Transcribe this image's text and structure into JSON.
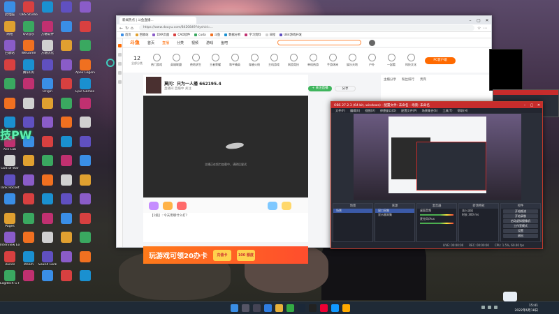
{
  "desktop": {
    "overlay_text": "技PW",
    "icons_col1": [
      "此电脑",
      "网络",
      "回收站",
      "",
      "",
      "",
      "",
      "Ace Lab",
      "God of War",
      "Tank Rocket",
      "",
      "Pages",
      "Interview Experience",
      "iTunes",
      "Logitech G HUB"
    ],
    "icons_col2": [
      "OBS Studio",
      "QQ音乐",
      "WeGame",
      "腾讯QQ",
      "",
      "",
      "",
      "",
      "",
      "",
      "",
      "",
      "",
      "steam",
      ""
    ],
    "icons_col3": [
      "",
      "方糖软件",
      "方糖优化",
      "",
      "Origin",
      "",
      "",
      "",
      "",
      "",
      "",
      "",
      "",
      "Sound Lock",
      ""
    ],
    "icons_col4": [
      "",
      "",
      "",
      "",
      "",
      "",
      "",
      "",
      "",
      "",
      "",
      "",
      "",
      "",
      ""
    ],
    "icons_col5": [
      "",
      "",
      "",
      "Apex Legends",
      "Epic Games Launcher",
      "",
      "",
      "",
      "",
      "",
      "",
      "",
      "",
      "",
      ""
    ]
  },
  "browser": {
    "tab_title": "新闻热点 | 斗鱼直播...",
    "url": "https://www.douyu.com/8420849?dyshid=...",
    "favorites": [
      "首页",
      "回收站",
      "DXR页面",
      "CAD软件",
      "cuda",
      "斗鱼",
      "数据分析",
      "学习资料",
      "日程",
      "UE4游戏开发"
    ],
    "site": {
      "logo": "斗鱼",
      "nav": [
        "首页",
        "直播",
        "分类",
        "视频",
        "游戏",
        "鱼吧"
      ],
      "active_nav": "直播",
      "pc_button": "PC客户端"
    },
    "category": {
      "count": "12",
      "count_label": "全部分类",
      "items": [
        "热门游戏",
        "英雄联盟",
        "绝地求生",
        "王者荣耀",
        "和平精英",
        "穿越火线",
        "主机游戏",
        "网游竞技",
        "单机热游",
        "手游休闲",
        "娱乐天地",
        "户外",
        "一起看",
        "科技文化"
      ]
    },
    "streamer": {
      "title": "莫问：只为一人播",
      "fans": "662195.4",
      "subtitle": "直播间 直播中 关注",
      "follow_label": "+ 关注直播",
      "share_label": "分享"
    },
    "video": {
      "loading_text": "主播正在努力加载中，请稍后尝试"
    },
    "chat_line": "【1级】: 今天用哪什么打?",
    "banner": {
      "text": "玩游戏可领20办卡",
      "btn1": "充值卡",
      "btn2": "100 额度"
    },
    "right_tabs": [
      "主播分享",
      "粉丝排行",
      "贵宾"
    ]
  },
  "obs": {
    "title": "OBS 27.2.3 (64 bit, windows) - 配置文件: 未命名 - 场景: 未命名",
    "menu": [
      "文件(F)",
      "编辑(E)",
      "视图(V)",
      "停靠窗口(D)",
      "配置文件(P)",
      "场景集合(S)",
      "工具(T)",
      "帮助(H)"
    ],
    "docks": {
      "scenes": {
        "header": "场景",
        "items": [
          "场景"
        ]
      },
      "sources": {
        "header": "来源",
        "items": [
          "窗口采集",
          "显示器采集"
        ]
      },
      "mixer": {
        "header": "混音器",
        "items": [
          "桌面音频",
          "麦克风/Aux"
        ]
      },
      "transitions": {
        "header": "转场特效",
        "items": [
          "淡入淡出",
          "时长 300 ms"
        ]
      },
      "controls": {
        "header": "控件",
        "buttons": [
          "开始推流",
          "开始录制",
          "启动虚拟摄像机",
          "工作室模式",
          "设置",
          "退出"
        ]
      }
    },
    "status": [
      "LIVE: 00:00:00",
      "REC: 00:00:00",
      "CPU: 1.5%, 60.00 fps"
    ]
  },
  "taskbar": {
    "time": "15:41",
    "date": "2022年6月18日"
  },
  "colors": {
    "accent": "#ff6a00",
    "obs_red": "#c72c2c",
    "taskbar": "#1f2a36"
  }
}
